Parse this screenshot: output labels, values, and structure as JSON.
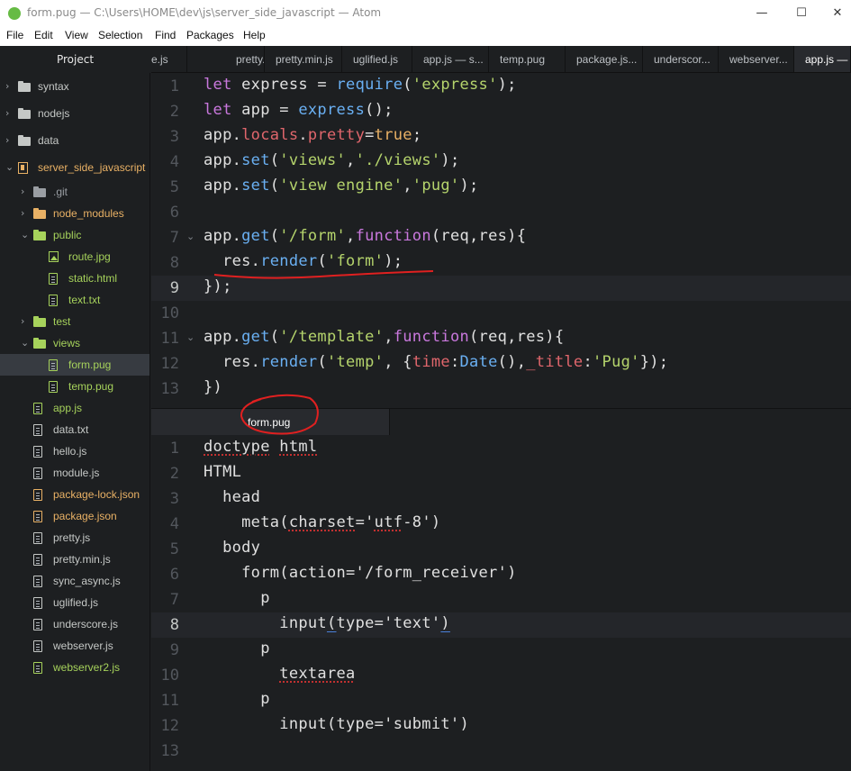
{
  "window": {
    "title": "form.pug — C:\\Users\\HOME\\dev\\js\\server_side_javascript — Atom",
    "minimize": "—",
    "maximize": "☐",
    "close": "✕"
  },
  "menu": [
    "File",
    "Edit",
    "View",
    "Selection",
    "Find",
    "Packages",
    "Help"
  ],
  "sidebar": {
    "title": "Project",
    "items": [
      {
        "label": "syntax",
        "kind": "dir",
        "color": "#c5c8c6"
      },
      {
        "label": "nodejs",
        "kind": "dir",
        "color": "#c5c8c6"
      },
      {
        "label": "data",
        "kind": "dir",
        "color": "#c5c8c6"
      },
      {
        "label": "server_side_javascript",
        "kind": "root",
        "color": "#e9b165"
      },
      {
        "label": ".git",
        "kind": "dir",
        "color": "#9a9ea3"
      },
      {
        "label": "node_modules",
        "kind": "dir",
        "color": "#e9b165"
      },
      {
        "label": "public",
        "kind": "dir",
        "color": "#a6d25b"
      },
      {
        "label": "route.jpg",
        "kind": "img",
        "color": "#a6d25b"
      },
      {
        "label": "static.html",
        "kind": "file",
        "color": "#a6d25b"
      },
      {
        "label": "text.txt",
        "kind": "file",
        "color": "#a6d25b"
      },
      {
        "label": "test",
        "kind": "dir",
        "color": "#a6d25b"
      },
      {
        "label": "views",
        "kind": "dir",
        "color": "#a6d25b"
      },
      {
        "label": "form.pug",
        "kind": "file",
        "color": "#a6d25b"
      },
      {
        "label": "temp.pug",
        "kind": "file",
        "color": "#a6d25b"
      },
      {
        "label": "app.js",
        "kind": "file",
        "color": "#a6d25b"
      },
      {
        "label": "data.txt",
        "kind": "file",
        "color": "#c5c8c6"
      },
      {
        "label": "hello.js",
        "kind": "file",
        "color": "#c5c8c6"
      },
      {
        "label": "module.js",
        "kind": "file",
        "color": "#c5c8c6"
      },
      {
        "label": "package-lock.json",
        "kind": "file",
        "color": "#e9b165"
      },
      {
        "label": "package.json",
        "kind": "file",
        "color": "#e9b165"
      },
      {
        "label": "pretty.js",
        "kind": "file",
        "color": "#c5c8c6"
      },
      {
        "label": "pretty.min.js",
        "kind": "file",
        "color": "#c5c8c6"
      },
      {
        "label": "sync_async.js",
        "kind": "file",
        "color": "#c5c8c6"
      },
      {
        "label": "uglified.js",
        "kind": "file",
        "color": "#c5c8c6"
      },
      {
        "label": "underscore.js",
        "kind": "file",
        "color": "#c5c8c6"
      },
      {
        "label": "webserver.js",
        "kind": "file",
        "color": "#c5c8c6"
      },
      {
        "label": "webserver2.js",
        "kind": "file",
        "color": "#a6d25b"
      }
    ]
  },
  "tabs": [
    "e.js",
    "pretty.js",
    "pretty.min.js",
    "uglified.js",
    "app.js — s...",
    "temp.pug",
    "package.js...",
    "underscor...",
    "webserver...",
    "app.js — s..."
  ],
  "top_editor": {
    "line_numbers": [
      "1",
      "2",
      "3",
      "4",
      "5",
      "6",
      "7",
      "8",
      "9",
      "10",
      "11",
      "12",
      "13"
    ],
    "lines": [
      [
        [
          "k",
          "let"
        ],
        [
          "p",
          " express = "
        ],
        [
          "f",
          "require"
        ],
        [
          "p",
          "("
        ],
        [
          "s",
          "'express'"
        ],
        [
          "p",
          ");"
        ]
      ],
      [
        [
          "k",
          "let"
        ],
        [
          "p",
          " app = "
        ],
        [
          "f",
          "express"
        ],
        [
          "p",
          "();"
        ]
      ],
      [
        [
          "p",
          "app."
        ],
        [
          "v",
          "locals"
        ],
        [
          "p",
          "."
        ],
        [
          "v",
          "pretty"
        ],
        [
          "p",
          "="
        ],
        [
          "n",
          "true"
        ],
        [
          "p",
          ";"
        ]
      ],
      [
        [
          "p",
          "app."
        ],
        [
          "f",
          "set"
        ],
        [
          "p",
          "("
        ],
        [
          "s",
          "'views'"
        ],
        [
          "p",
          ","
        ],
        [
          "s",
          "'./views'"
        ],
        [
          "p",
          ");"
        ]
      ],
      [
        [
          "p",
          "app."
        ],
        [
          "f",
          "set"
        ],
        [
          "p",
          "("
        ],
        [
          "s",
          "'view engine'"
        ],
        [
          "p",
          ","
        ],
        [
          "s",
          "'pug'"
        ],
        [
          "p",
          ");"
        ]
      ],
      [],
      [
        [
          "p",
          "app."
        ],
        [
          "f",
          "get"
        ],
        [
          "p",
          "("
        ],
        [
          "s",
          "'/form'"
        ],
        [
          "p",
          ","
        ],
        [
          "k",
          "function"
        ],
        [
          "p",
          "(req,res){"
        ]
      ],
      [
        [
          "p",
          "  res."
        ],
        [
          "f",
          "render"
        ],
        [
          "p",
          "("
        ],
        [
          "s",
          "'form'"
        ],
        [
          "p",
          ");"
        ]
      ],
      [
        [
          "p",
          "});"
        ]
      ],
      [],
      [
        [
          "p",
          "app."
        ],
        [
          "f",
          "get"
        ],
        [
          "p",
          "("
        ],
        [
          "s",
          "'/template'"
        ],
        [
          "p",
          ","
        ],
        [
          "k",
          "function"
        ],
        [
          "p",
          "(req,res){"
        ]
      ],
      [
        [
          "p",
          "  res."
        ],
        [
          "f",
          "render"
        ],
        [
          "p",
          "("
        ],
        [
          "s",
          "'temp'"
        ],
        [
          "p",
          ", {"
        ],
        [
          "v",
          "time"
        ],
        [
          "p",
          ":"
        ],
        [
          "f",
          "Date"
        ],
        [
          "p",
          "(),"
        ],
        [
          "v",
          "_title"
        ],
        [
          "p",
          ":"
        ],
        [
          "s",
          "'Pug'"
        ],
        [
          "p",
          "});"
        ]
      ],
      [
        [
          "p",
          "})"
        ]
      ]
    ]
  },
  "bottom_tab": "form.pug",
  "bottom_editor": {
    "line_numbers": [
      "1",
      "2",
      "3",
      "4",
      "5",
      "6",
      "7",
      "8",
      "9",
      "10",
      "11",
      "12",
      "13"
    ],
    "lines": [
      [
        [
          "sq",
          "doctype"
        ],
        [
          "p",
          " "
        ],
        [
          "sq",
          "html"
        ]
      ],
      [
        [
          "p",
          "HTML"
        ]
      ],
      [
        [
          "p",
          "  head"
        ]
      ],
      [
        [
          "p",
          "    meta("
        ],
        [
          "sq",
          "charset"
        ],
        [
          "p",
          "='"
        ],
        [
          "sq",
          "utf"
        ],
        [
          "p",
          "-8')"
        ]
      ],
      [
        [
          "p",
          "  body"
        ]
      ],
      [
        [
          "p",
          "    form(action='/form_receiver')"
        ]
      ],
      [
        [
          "p",
          "      p"
        ]
      ],
      [
        [
          "p",
          "        input"
        ],
        [
          "bu",
          "("
        ],
        [
          "p",
          "type='text'"
        ],
        [
          "bu",
          ")"
        ]
      ],
      [
        [
          "p",
          "      p"
        ]
      ],
      [
        [
          "p",
          "        "
        ],
        [
          "sq",
          "textarea"
        ]
      ],
      [
        [
          "p",
          "      p"
        ]
      ],
      [
        [
          "p",
          "        input(type='submit')"
        ]
      ],
      []
    ]
  }
}
